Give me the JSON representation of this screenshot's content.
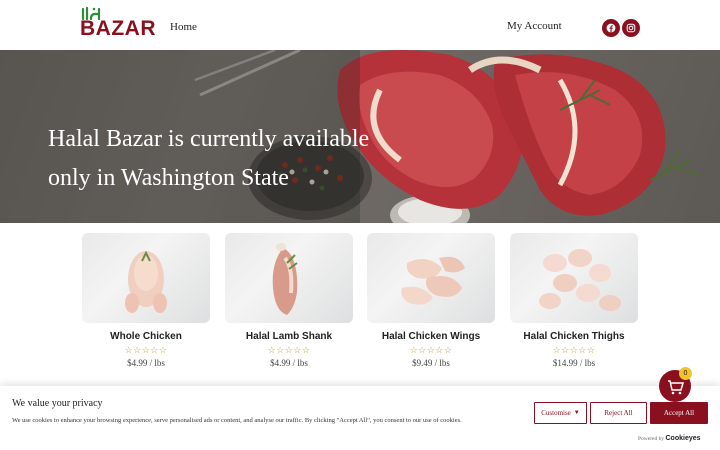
{
  "header": {
    "logo_text": "BAZAR",
    "nav": {
      "home_label": "Home",
      "account_label": "My Account"
    },
    "social": [
      {
        "name": "facebook-icon"
      },
      {
        "name": "instagram-icon"
      }
    ]
  },
  "hero": {
    "title": "Halal Bazar is currently available only in Washington State"
  },
  "products": [
    {
      "name": "Whole Chicken",
      "stars": "☆☆☆☆☆",
      "price": "$4.99 / lbs"
    },
    {
      "name": "Halal Lamb Shank",
      "stars": "☆☆☆☆☆",
      "price": "$4.99 / lbs"
    },
    {
      "name": "Halal Chicken Wings",
      "stars": "☆☆☆☆☆",
      "price": "$9.49 / lbs"
    },
    {
      "name": "Halal Chicken Thighs",
      "stars": "☆☆☆☆☆",
      "price": "$14.99 / lbs"
    }
  ],
  "cart": {
    "count": "0"
  },
  "cookie": {
    "title": "We value your privacy",
    "text": "We use cookies to enhance your browsing experience, serve personalised ads or content, and analyse our traffic. By clicking \"Accept All\", you consent to our use of cookies.",
    "customise_label": "Customise",
    "reject_label": "Reject All",
    "accept_label": "Accept All",
    "powered_label": "Powered by",
    "powered_brand": "Cookieyes"
  },
  "colors": {
    "brand": "#8a1020",
    "star": "#c99a2e",
    "badge": "#f2c230"
  }
}
